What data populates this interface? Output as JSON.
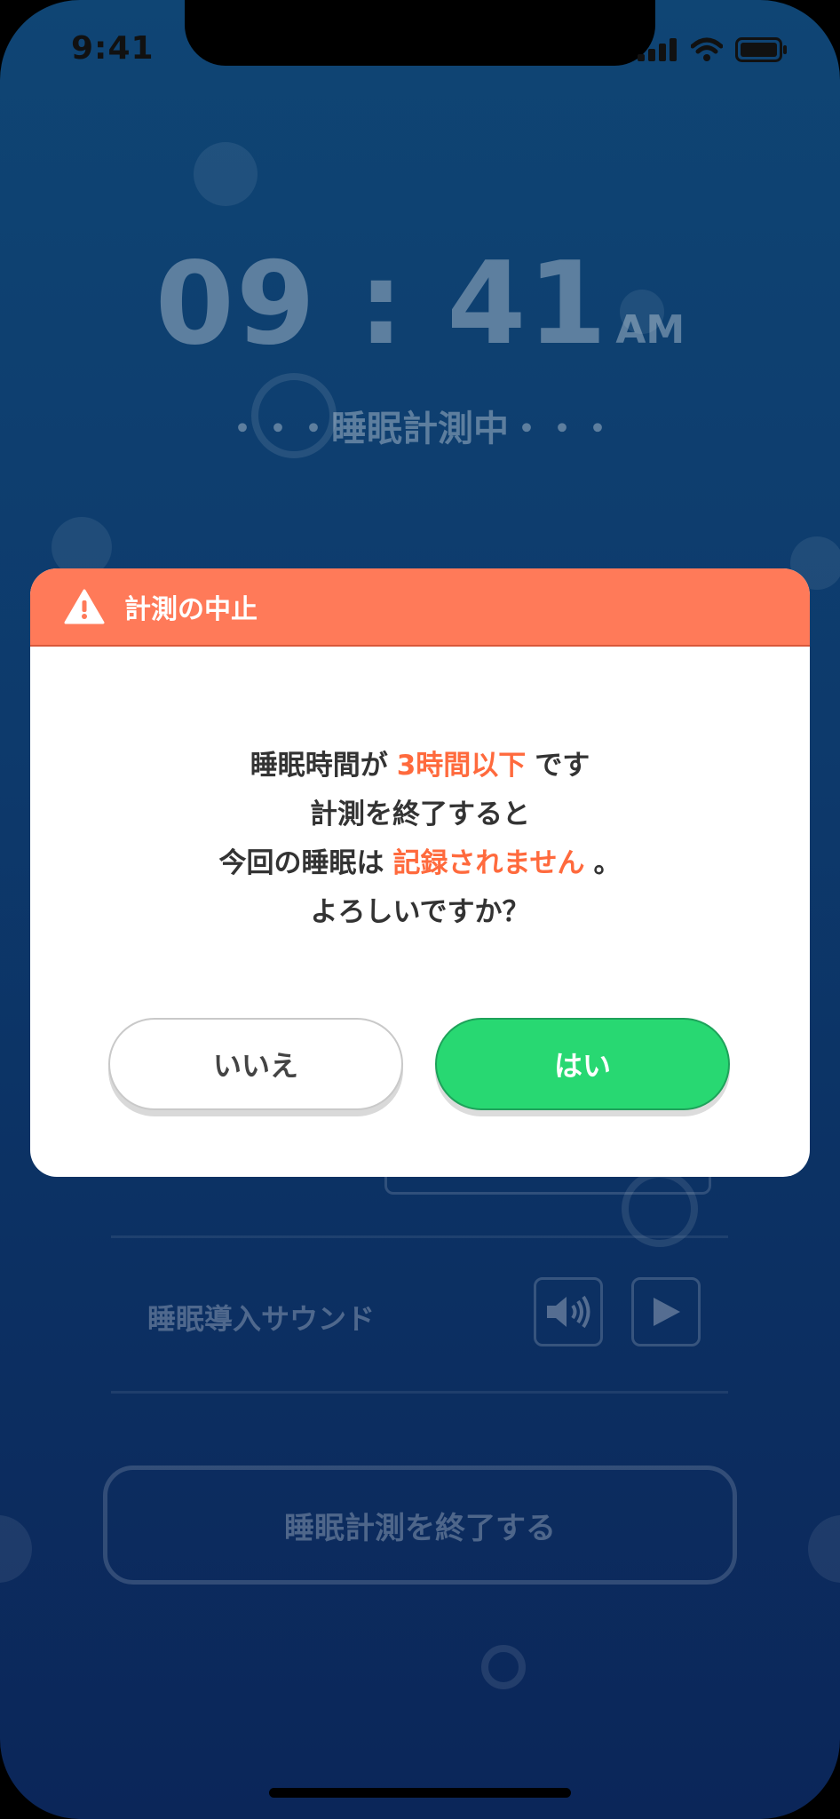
{
  "status_bar": {
    "time": "9:41"
  },
  "clock": {
    "time": "09 : 41",
    "ampm": "AM"
  },
  "status": {
    "measuring": "・・・睡眠計測中・・・"
  },
  "settings": {
    "sound_label": "睡眠導入サウンド"
  },
  "end_button": {
    "label": "睡眠計測を終了する"
  },
  "dialog": {
    "title": "計測の中止",
    "line1_a": "睡眠時間が",
    "line1_b": "3時間以下",
    "line1_c": "です",
    "line2": "計測を終了すると",
    "line3_a": "今回の睡眠は",
    "line3_b": "記録されません",
    "line3_c": "。",
    "line4": "よろしいですか？",
    "no_label": "いいえ",
    "yes_label": "はい"
  },
  "colors": {
    "accent": "#ff6a3d",
    "header": "#ff7a59",
    "confirm": "#28d872"
  }
}
